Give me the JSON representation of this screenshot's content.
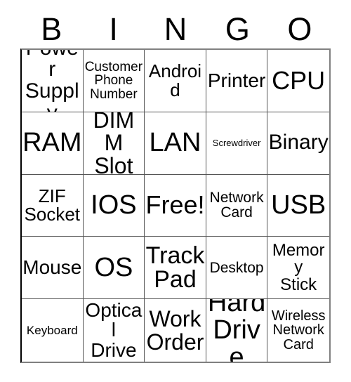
{
  "card": {
    "title": "BINGO",
    "free_space_label": "Free!",
    "colors": {
      "background": "#ffffff",
      "text": "#000000",
      "grid_line": "#555555",
      "border": "#808080"
    },
    "header": {
      "letters": [
        {
          "label": "B"
        },
        {
          "label": "I"
        },
        {
          "label": "N"
        },
        {
          "label": "G"
        },
        {
          "label": "O"
        }
      ]
    },
    "grid": {
      "columns": 5,
      "rows": 5,
      "cells": [
        {
          "text": "Power\nSupply",
          "size": "fs-30"
        },
        {
          "text": "Customer\nPhone\nNumber",
          "size": "fs-19"
        },
        {
          "text": "Android",
          "size": "fs-26"
        },
        {
          "text": "Printer",
          "size": "fs-28"
        },
        {
          "text": "CPU",
          "size": "fs-36"
        },
        {
          "text": "RAM",
          "size": "fs-38"
        },
        {
          "text": "DIMM\nSlot",
          "size": "fs-32"
        },
        {
          "text": "LAN",
          "size": "fs-38"
        },
        {
          "text": "Screwdriver",
          "size": "fs-13"
        },
        {
          "text": "Binary",
          "size": "fs-30"
        },
        {
          "text": "ZIF\nSocket",
          "size": "fs-26"
        },
        {
          "text": "IOS",
          "size": "fs-38"
        },
        {
          "text": "Free!",
          "size": "fs-36"
        },
        {
          "text": "Network\nCard",
          "size": "fs-21"
        },
        {
          "text": "USB",
          "size": "fs-38"
        },
        {
          "text": "Mouse",
          "size": "fs-28"
        },
        {
          "text": "OS",
          "size": "fs-38"
        },
        {
          "text": "Track\nPad",
          "size": "fs-34"
        },
        {
          "text": "Desktop",
          "size": "fs-21"
        },
        {
          "text": "Memory\nStick",
          "size": "fs-24"
        },
        {
          "text": "Keyboard",
          "size": "fs-17"
        },
        {
          "text": "Optical\nDrive",
          "size": "fs-28"
        },
        {
          "text": "Work\nOrder",
          "size": "fs-32"
        },
        {
          "text": "Hard\nDrive",
          "size": "fs-38"
        },
        {
          "text": "Wireless\nNetwork\nCard",
          "size": "fs-20"
        }
      ]
    }
  }
}
